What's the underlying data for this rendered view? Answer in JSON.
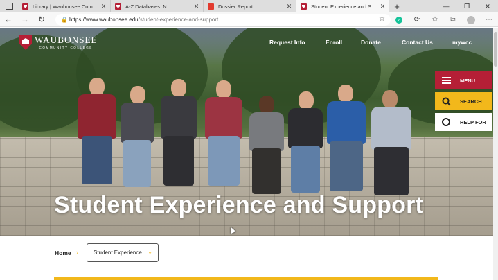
{
  "browser": {
    "tabs": [
      {
        "title": "Library | Waubonsee Communit",
        "favicon": "waubonsee-favicon",
        "active": false
      },
      {
        "title": "A-Z Databases: N",
        "favicon": "waubonsee-favicon",
        "active": false
      },
      {
        "title": "Dossier Report",
        "favicon": "dossier-favicon",
        "active": false
      },
      {
        "title": "Student Experience and Support",
        "favicon": "waubonsee-favicon",
        "active": true
      }
    ],
    "new_tab": "+",
    "url_host": "https://www.waubonsee.edu",
    "url_path": "/student-experience-and-support"
  },
  "site": {
    "logo_main": "WAUBONSEE",
    "logo_sub": "COMMUNITY COLLEGE",
    "nav": [
      "Request Info",
      "Enroll",
      "Donate",
      "Contact Us",
      "mywcc"
    ],
    "side_menu": {
      "menu": "MENU",
      "search": "SEARCH",
      "help": "HELP FOR"
    },
    "hero_title": "Student Experience and Support",
    "breadcrumb": {
      "home": "Home",
      "separator": "›",
      "current": "Student Experience"
    },
    "colors": {
      "brand_red": "#b51f36",
      "gold": "#f2b81b"
    }
  }
}
